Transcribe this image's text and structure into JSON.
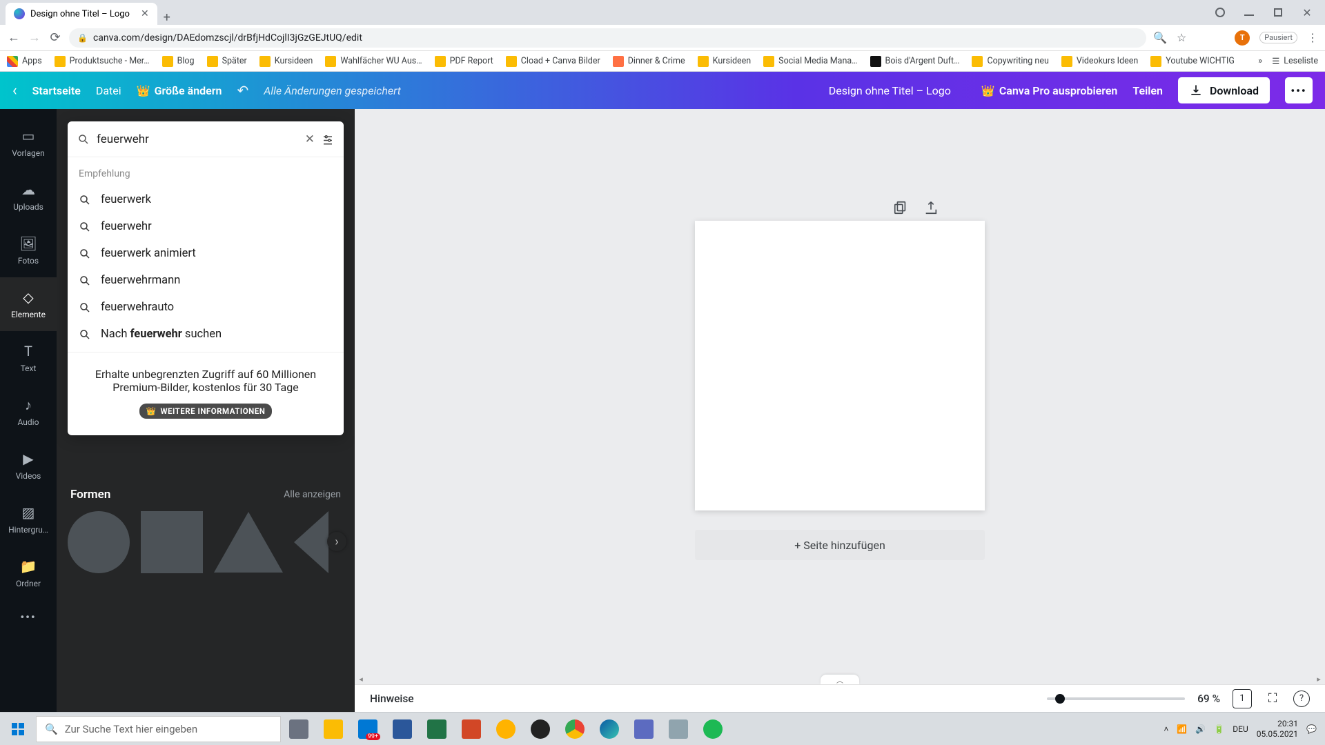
{
  "browser": {
    "tab_title": "Design ohne Titel – Logo",
    "url": "canva.com/design/DAEdomzscjl/drBfjHdCojlI3jGzGEJtUQ/edit",
    "paused_label": "Pausiert",
    "avatar_initial": "T"
  },
  "bookmarks": {
    "apps": "Apps",
    "items": [
      "Produktsuche - Mer…",
      "Blog",
      "Später",
      "Kursideen",
      "Wahlfächer WU Aus…",
      "PDF Report",
      "Cload + Canva Bilder",
      "Dinner & Crime",
      "Kursideen",
      "Social Media Mana…",
      "Bois d'Argent Duft…",
      "Copywriting neu",
      "Videokurs Ideen",
      "Youtube WICHTIG"
    ],
    "reading_list": "Leseliste"
  },
  "header": {
    "home": "Startseite",
    "file": "Datei",
    "resize": "Größe ändern",
    "saved": "Alle Änderungen gespeichert",
    "doc_title": "Design ohne Titel – Logo",
    "pro": "Canva Pro ausprobieren",
    "share": "Teilen",
    "download": "Download"
  },
  "rail": {
    "templates": "Vorlagen",
    "uploads": "Uploads",
    "photos": "Fotos",
    "elements": "Elemente",
    "text": "Text",
    "audio": "Audio",
    "videos": "Videos",
    "background": "Hintergru…",
    "folder": "Ordner"
  },
  "search": {
    "value": "feuerwehr",
    "suggestion_heading": "Empfehlung",
    "suggestions": [
      "feuerwerk",
      "feuerwehr",
      "feuerwerk animiert",
      "feuerwehrmann",
      "feuerwehrauto"
    ],
    "search_for_prefix": "Nach ",
    "search_for_term": "feuerwehr",
    "search_for_suffix": " suchen",
    "promo_text": "Erhalte unbegrenzten Zugriff auf 60 Millionen Premium-Bilder, kostenlos für 30 Tage",
    "promo_button": "WEITERE INFORMATIONEN"
  },
  "shapes": {
    "heading": "Formen",
    "see_all": "Alle anzeigen"
  },
  "canvas": {
    "add_page": "+ Seite hinzufügen"
  },
  "footer": {
    "notes": "Hinweise",
    "zoom": "69 %",
    "page_count": "1"
  },
  "taskbar": {
    "search_placeholder": "Zur Suche Text hier eingeben",
    "badge": "99+",
    "lang": "DEU",
    "time": "20:31",
    "date": "05.05.2021"
  }
}
